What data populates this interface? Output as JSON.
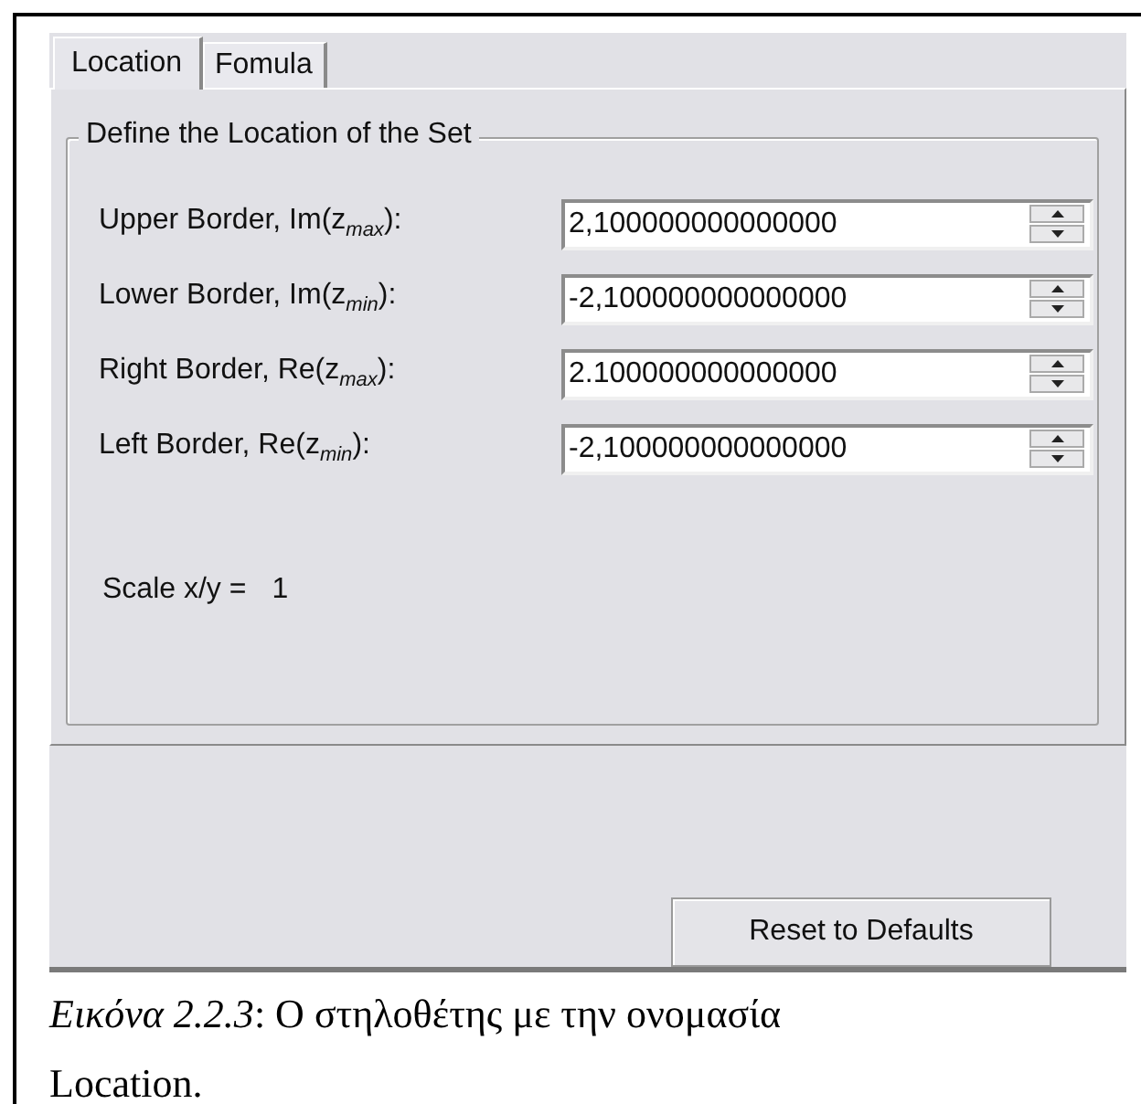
{
  "tabs": [
    {
      "label": "Location",
      "selected": true
    },
    {
      "label": "Fomula",
      "selected": false
    }
  ],
  "group": {
    "title": "Define the Location of the Set",
    "fields": [
      {
        "label": "Upper Border, Im(z$_{max}$):",
        "value": "2,100000000000000"
      },
      {
        "label": "Lower Border, Im(z$_{min}$):",
        "value": "-2,100000000000000"
      },
      {
        "label": "Right Border, Re(z$_{max}$):",
        "value": "2.100000000000000"
      },
      {
        "label": "Left Border, Re(z$_{min}$):",
        "value": "-2,100000000000000"
      }
    ],
    "scale_label": "Scale x/y =",
    "scale_value": "1"
  },
  "buttons": [
    "Reset to Defaults"
  ],
  "caption": "*Εικόνα 2.2.3*: Ο στηλοθέτης με την ονομασία Location."
}
